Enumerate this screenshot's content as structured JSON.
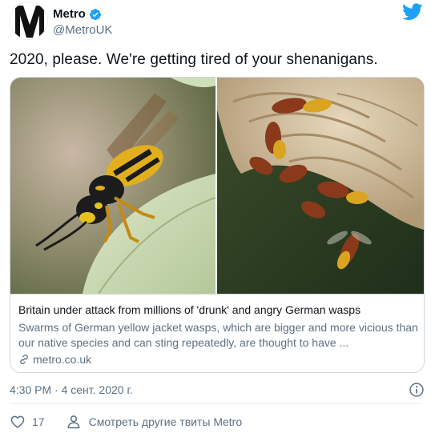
{
  "header": {
    "display_name": "Metro",
    "handle": "@MetroUK",
    "avatar_icon": "metro-logo-icon",
    "verified_icon": "verified-badge-icon",
    "logo_icon": "twitter-bird-icon"
  },
  "tweet": {
    "text": "2020, please. We're getting tired of your shenanigans."
  },
  "card": {
    "images": [
      {
        "name": "wasp-on-leaf-photo"
      },
      {
        "name": "hornets-on-nest-photo"
      }
    ],
    "title": "Britain under attack from millions of 'drunk' and angry German wasps",
    "description": "Swarms of German yellow jacket wasps, which are bigger and more vicious than our native species and can sting repeatedly, are thought to have ...",
    "domain": "metro.co.uk",
    "domain_icon": "link-icon"
  },
  "meta": {
    "timestamp": "4:30 PM · 4 сент. 2020 г.",
    "info_icon": "info-icon"
  },
  "actions": {
    "like_icon": "heart-icon",
    "like_count": "17",
    "more_icon": "user-icon",
    "more_label": "Смотреть другие твиты Metro"
  },
  "colors": {
    "brand_blue": "#1da1f2",
    "text_primary": "#0f1419",
    "text_secondary": "#5b7083",
    "border": "#cfd9de"
  }
}
